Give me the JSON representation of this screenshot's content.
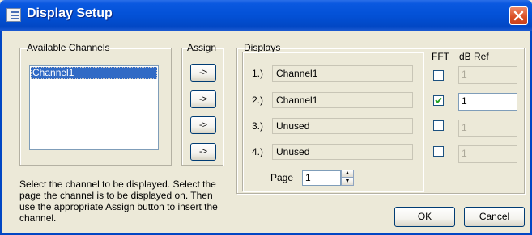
{
  "window": {
    "title": "Display Setup"
  },
  "available_channels": {
    "title": "Available Channels",
    "items": [
      "Channel1"
    ],
    "help_lines": [
      "Select the channel to be displayed. Select the",
      "page the channel is to be displayed on. Then",
      "use the appropriate Assign button to insert the",
      "channel."
    ]
  },
  "assign": {
    "title": "Assign",
    "button_label": "->"
  },
  "displays": {
    "title": "Displays",
    "fft_header": "FFT",
    "dbref_header": "dB Ref",
    "rows": [
      {
        "label": "1.)",
        "channel": "Channel1",
        "fft_checked": false,
        "dbref": "1",
        "dbref_enabled": false
      },
      {
        "label": "2.)",
        "channel": "Channel1",
        "fft_checked": true,
        "dbref": "1",
        "dbref_enabled": true
      },
      {
        "label": "3.)",
        "channel": "Unused",
        "fft_checked": false,
        "dbref": "1",
        "dbref_enabled": false
      },
      {
        "label": "4.)",
        "channel": "Unused",
        "fft_checked": false,
        "dbref": "1",
        "dbref_enabled": false
      }
    ],
    "page_label": "Page",
    "page_value": "1"
  },
  "buttons": {
    "ok": "OK",
    "cancel": "Cancel"
  }
}
